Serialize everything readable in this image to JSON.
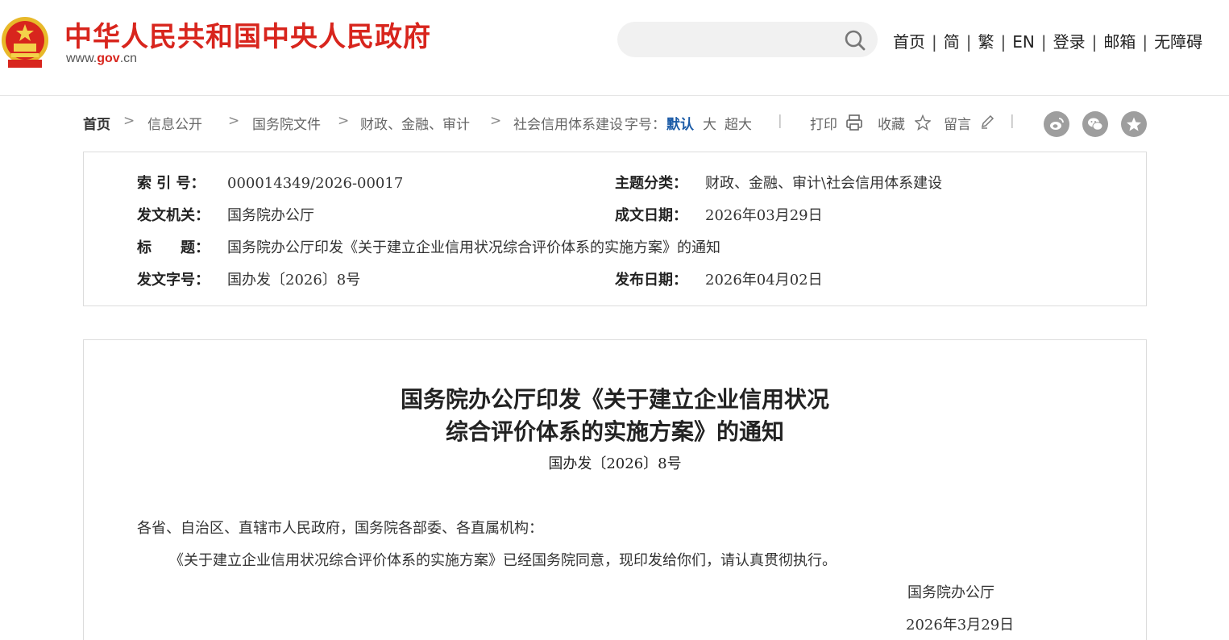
{
  "header": {
    "site_title": "中华人民共和国中央人民政府",
    "domain_prefix": "www.",
    "domain_mid": "gov",
    "domain_suffix": ".cn",
    "search_placeholder": "",
    "nav": [
      "首页",
      "简",
      "繁",
      "EN",
      "登录",
      "邮箱",
      "无障碍"
    ]
  },
  "breadcrumb": {
    "items": [
      "首页",
      "信息公开",
      "国务院文件",
      "财政、金融、审计",
      "社会信用体系建设"
    ],
    "font_label": "字号：",
    "font_default": "默认",
    "font_large": "大",
    "font_xlarge": "超大",
    "print": "打印",
    "favorite": "收藏",
    "comment": "留言"
  },
  "share_icons": [
    "weibo-icon",
    "wechat-icon",
    "star-share-icon"
  ],
  "meta": {
    "index_label": "索 引 号：",
    "index_value": "000014349/2026-00017",
    "topic_label": "主题分类：",
    "topic_value": "财政、金融、审计\\社会信用体系建设",
    "issuer_label": "发文机关：",
    "issuer_value": "国务院办公厅",
    "written_label": "成文日期：",
    "written_value": "2026年03月29日",
    "title_label": "标　　题：",
    "title_value": "国务院办公厅印发《关于建立企业信用状况综合评价体系的实施方案》的通知",
    "docno_label": "发文字号：",
    "docno_value": "国办发〔2026〕8号",
    "publish_label": "发布日期：",
    "publish_value": "2026年04月02日"
  },
  "document": {
    "title_line1": "国务院办公厅印发《关于建立企业信用状况",
    "title_line2": "综合评价体系的实施方案》的通知",
    "code": "国办发〔2026〕8号",
    "salutation": "各省、自治区、直辖市人民政府，国务院各部委、各直属机构：",
    "body": "《关于建立企业信用状况综合评价体系的实施方案》已经国务院同意，现印发给你们，请认真贯彻执行。",
    "signer": "国务院办公厅",
    "date": "2026年3月29日"
  },
  "colors": {
    "brand_red": "#d8251d",
    "link_blue": "#1a5aa6"
  }
}
